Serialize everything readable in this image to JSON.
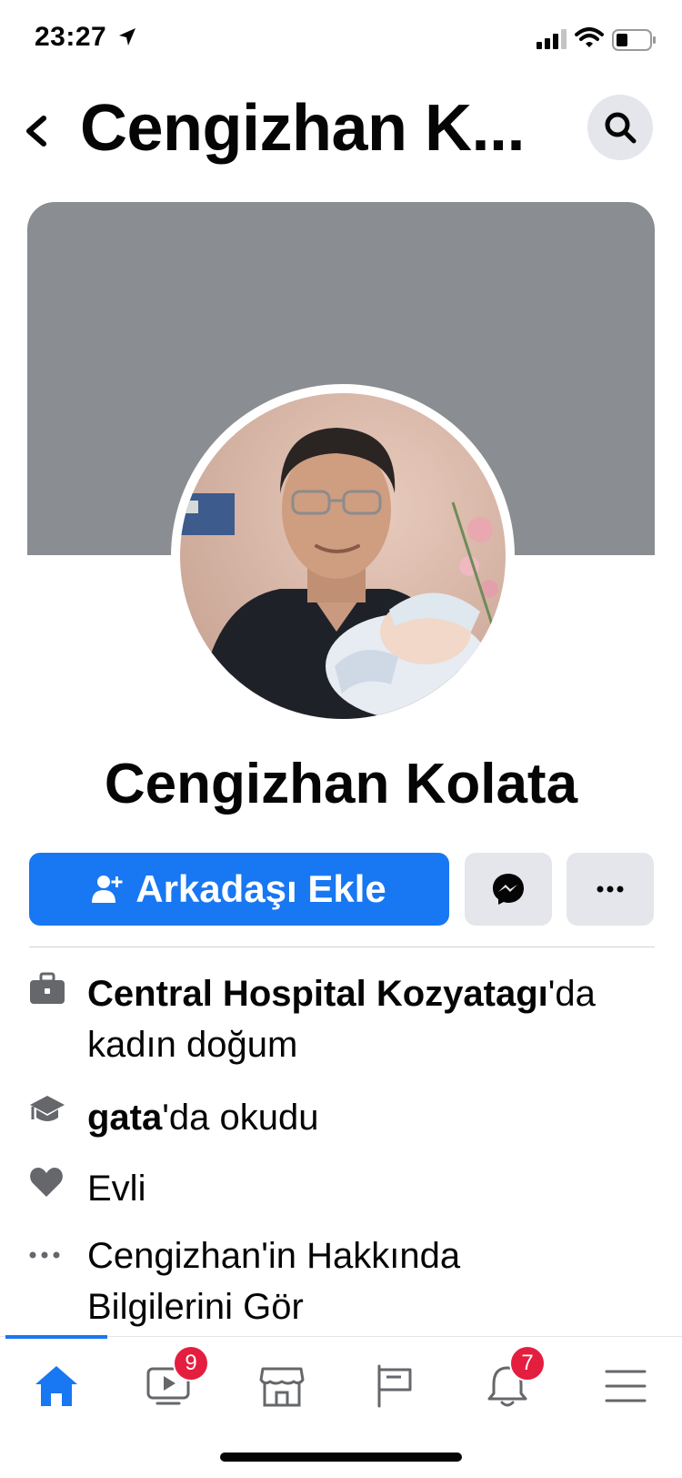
{
  "status_bar": {
    "time": "23:27"
  },
  "header": {
    "title": "Cengizhan K..."
  },
  "profile": {
    "name": "Cengizhan Kolata"
  },
  "actions": {
    "add_friend_label": "Arkadaşı Ekle"
  },
  "info": {
    "work_place": "Central Hospital Kozyatagı",
    "work_suffix": "'da",
    "work_role": "kadın doğum",
    "school": "gata",
    "school_suffix": "'da okudu",
    "relationship": "Evli",
    "about_line1": "Cengizhan'in Hakkında",
    "about_line2": "Bilgilerini Gör"
  },
  "nav": {
    "watch_badge": "9",
    "notifications_badge": "7"
  },
  "colors": {
    "accent": "#1877f2",
    "badge": "#e41e3f",
    "cover": "#8a8d91"
  }
}
